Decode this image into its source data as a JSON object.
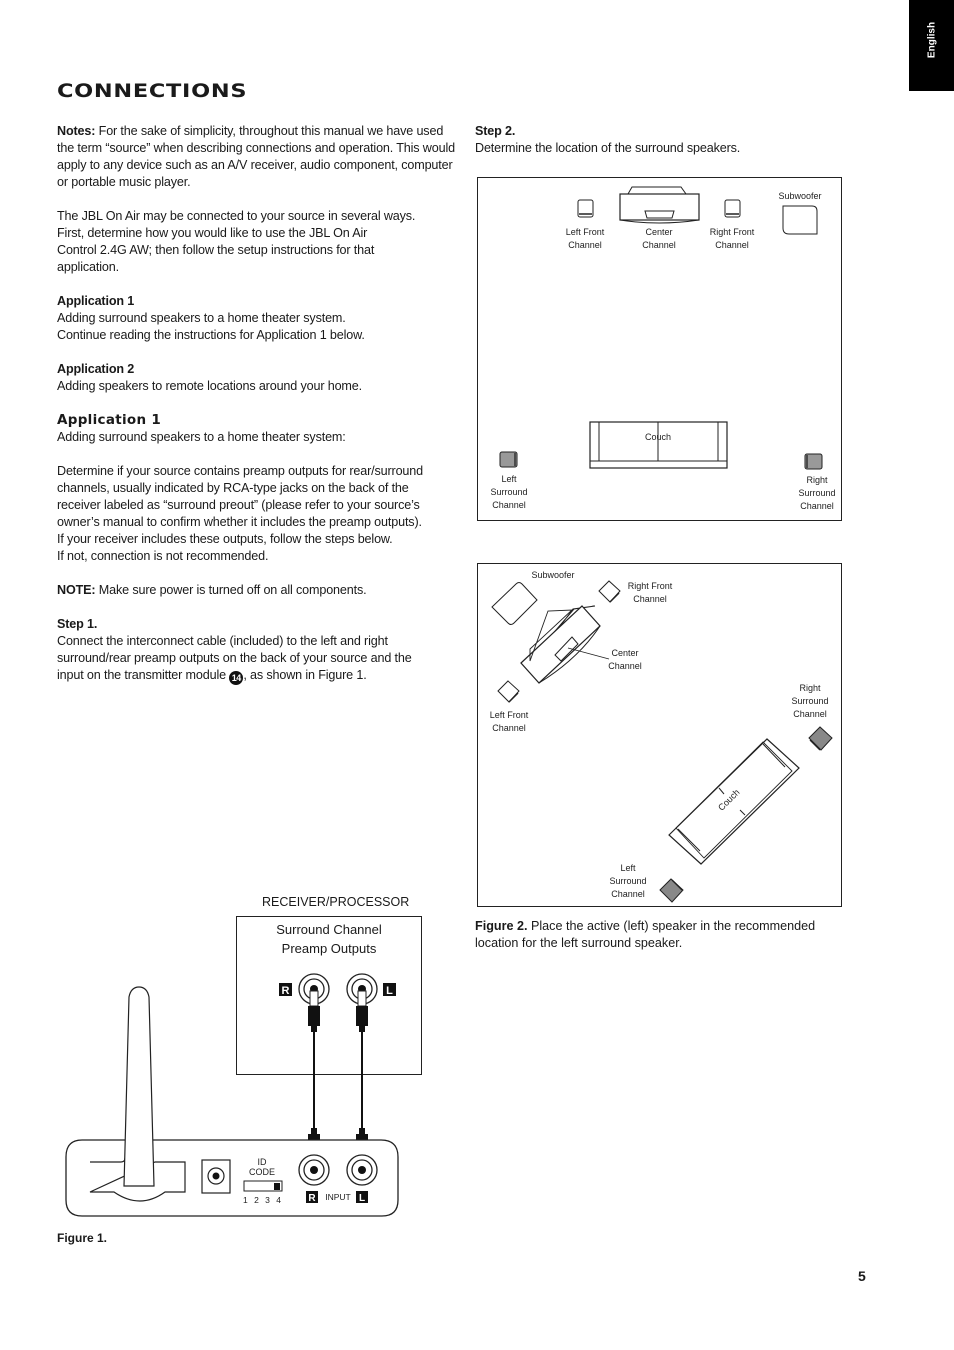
{
  "language_tab": "English",
  "page_title": "CONNECTIONS",
  "left_column": {
    "notes": {
      "label": "Notes:",
      "text": " For the sake of simplicity, throughout this manual we have used the term “source” when describing connections and operation. This would apply to any device such as an A/V receiver, audio component, computer or portable music player."
    },
    "intro_lines": [
      "The JBL On Air may be connected to your source in several ways.",
      "First, determine how you would like to use the JBL On Air",
      "Control 2.4G AW; then follow the setup instructions for that",
      "application."
    ],
    "application1_summary": {
      "heading": "Application 1",
      "lines": [
        "Adding surround speakers to a home theater system.",
        "Continue reading the instructions for Application 1 below."
      ]
    },
    "application2_summary": {
      "heading": "Application 2",
      "lines": [
        "Adding speakers to remote locations around your home."
      ]
    },
    "application1_section": {
      "heading": "Application 1",
      "subtitle": "Adding surround speakers to a home theater system:",
      "lines": [
        "Determine if your source contains preamp outputs for rear/surround",
        "channels, usually indicated by RCA-type jacks on the back of the",
        "receiver labeled as “surround preout” (please refer to your source’s",
        "owner’s manual to confirm whether it includes the preamp outputs).",
        "If your receiver includes these outputs, follow the steps below.",
        "If not, connection is not recommended."
      ]
    },
    "note": {
      "label": "NOTE:",
      "text": " Make sure power is turned off on all components."
    },
    "step1": {
      "heading": "Step 1.",
      "lines": [
        "Connect the interconnect cable (included) to the left and right",
        "surround/rear preamp outputs on the back of your source and the"
      ],
      "last_line_before": "input on the transmitter module ",
      "callout_number": "14",
      "last_line_after": ", as shown in Figure 1."
    }
  },
  "right_column": {
    "step2": {
      "heading": "Step 2.",
      "text": "Determine the location of the surround speakers."
    }
  },
  "figure2_top": {
    "labels": {
      "left_front": [
        "Left Front",
        "Channel"
      ],
      "center": [
        "Center",
        "Channel"
      ],
      "right_front": [
        "Right Front",
        "Channel"
      ],
      "subwoofer": "Subwoofer",
      "couch": "Couch",
      "left_surround": [
        "Left",
        "Surround",
        "Channel"
      ],
      "right_surround": [
        "Right",
        "Surround",
        "Channel"
      ]
    }
  },
  "figure2_bottom": {
    "labels": {
      "subwoofer": "Subwoofer",
      "right_front": [
        "Right Front",
        "Channel"
      ],
      "center": [
        "Center",
        "Channel"
      ],
      "left_front": [
        "Left Front",
        "Channel"
      ],
      "right_surround": [
        "Right",
        "Surround",
        "Channel"
      ],
      "couch": "Couch",
      "left_surround": [
        "Left",
        "Surround",
        "Channel"
      ]
    }
  },
  "figure2_caption": {
    "label": "Figure 2.",
    "text": " Place the active (left) speaker in the recommended location for the left surround speaker."
  },
  "figure1": {
    "receiver_label": "RECEIVER/PROCESSOR",
    "receiver_title": [
      "Surround Channel",
      "Preamp Outputs"
    ],
    "jack_r": "R",
    "jack_l": "L",
    "id_code": [
      "ID",
      "CODE"
    ],
    "id_positions": "1 2 3 4",
    "input_label": "INPUT",
    "caption": "Figure 1."
  },
  "page_number": "5"
}
